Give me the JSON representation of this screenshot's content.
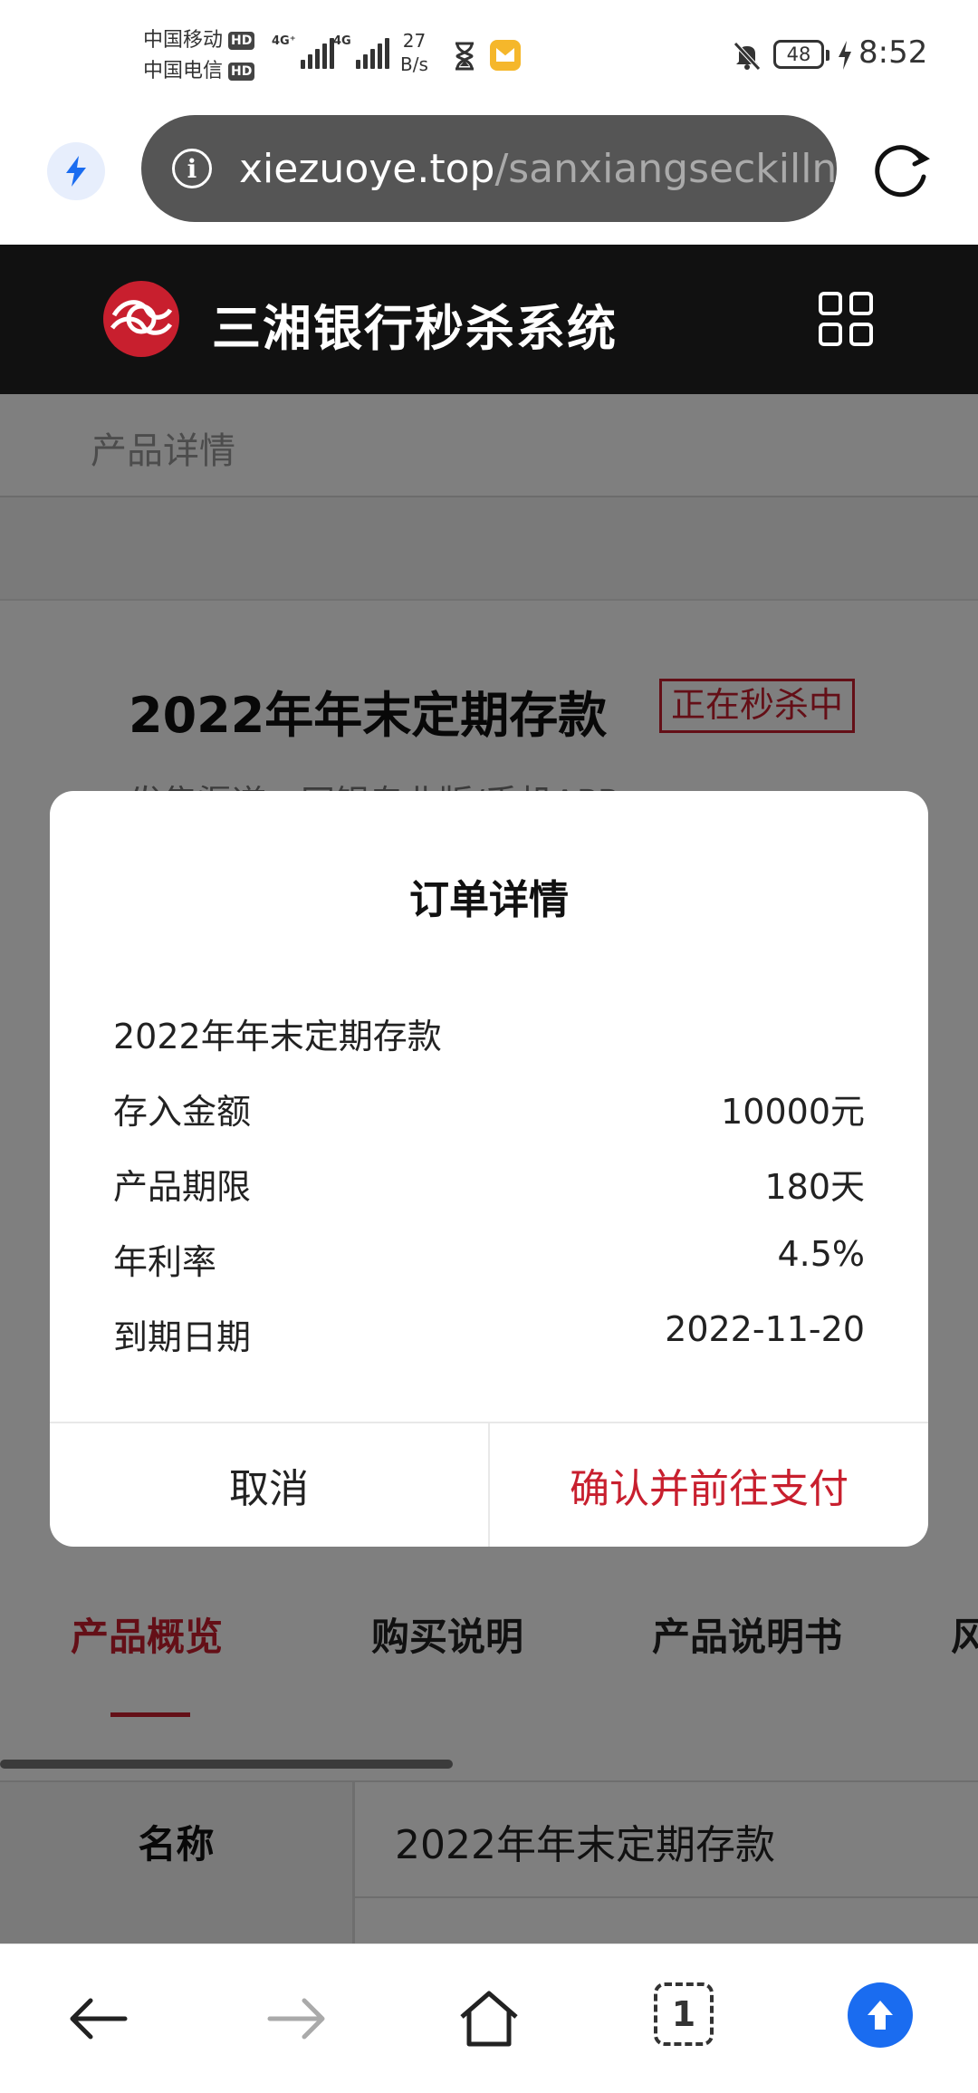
{
  "status_bar": {
    "carrier1": "中国移动",
    "carrier2": "中国电信",
    "hd_badge": "HD",
    "network1": "4G⁺",
    "network2": "4G",
    "speed_value": "27",
    "speed_unit": "B/s",
    "battery": "48",
    "time": "8:52"
  },
  "address_bar": {
    "url_domain": "xiezuoye.top",
    "url_path": "/sanxiangseckilln",
    "info_icon": "ⓘ"
  },
  "site_header": {
    "title": "三湘银行秒杀系统"
  },
  "page": {
    "breadcrumb": "产品详情",
    "product_title": "2022年年末定期存款",
    "status_badge": "正在秒杀中",
    "channel_text": "发售渠道：网银专业版/手机APP",
    "section_tabs": [
      "产品概览",
      "购买说明",
      "产品说明书",
      "风"
    ],
    "table": {
      "label": "名称",
      "value": "2022年年末定期存款"
    }
  },
  "modal": {
    "title": "订单详情",
    "product_name": "2022年年末定期存款",
    "rows": [
      {
        "label": "存入金额",
        "value": "10000元"
      },
      {
        "label": "产品期限",
        "value": "180天"
      },
      {
        "label": "年利率",
        "value": "4.5%"
      },
      {
        "label": "到期日期",
        "value": "2022-11-20"
      }
    ],
    "cancel_label": "取消",
    "confirm_label": "确认并前往支付"
  },
  "bottom_nav": {
    "tab_count": "1"
  },
  "colors": {
    "accent": "#c81f2e",
    "header_bg": "#111111",
    "url_pill": "#555555",
    "update_blue": "#1a6cf0"
  }
}
